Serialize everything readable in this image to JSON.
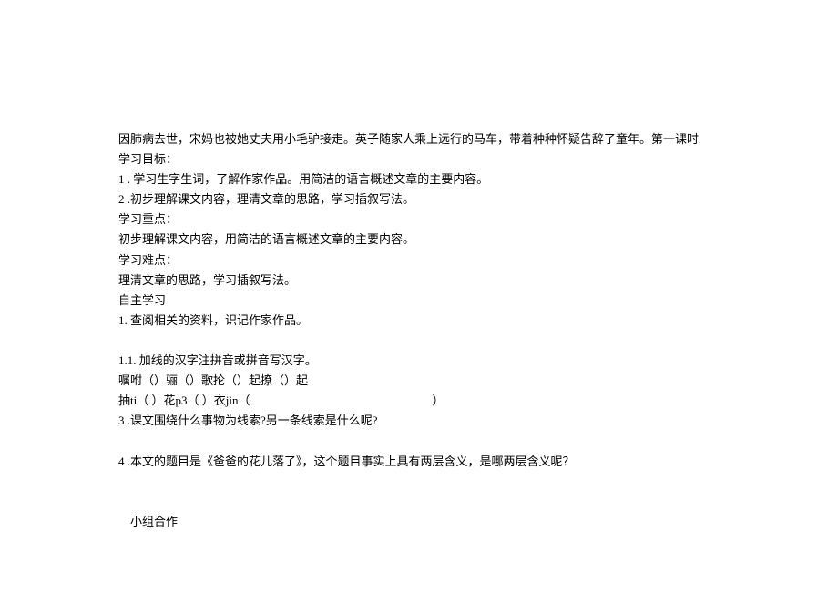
{
  "lines": {
    "l1": "因肺病去世，宋妈也被她丈夫用小毛驴接走。英子随家人乘上远行的马车，带着种种怀疑告辞了童年。第一课时",
    "l2": "学习目标：",
    "l3": "1 . 学习生字生词，了解作家作品。用简洁的语言概述文章的主要内容。",
    "l4": "2  .初步理解课文内容，理清文章的思路，学习插叙写法。",
    "l5": "学习重点：",
    "l6": "初步理解课文内容，用简洁的语言概述文章的主要内容。",
    "l7": "学习难点：",
    "l8": "理清文章的思路，学习插叙写法。",
    "l9": "自主学习",
    "l10": "1. 查阅相关的资料，识记作家作品。",
    "l11": "1.1.       加线的汉字注拼音或拼音写汉字。",
    "l12": "嘱咐（）骊（）歌抡（）起撩（）起",
    "l13a": "抽ti（  ）花p3（  ）衣jin（",
    "l13b": "）",
    "l14": "3   .课文围绕什么事物为线索?另一条线索是什么呢?",
    "l15": "4   .本文的题目是《爸爸的花儿落了》，这个题目事实上具有两层含义，是哪两层含义呢？",
    "l16": "小组合作"
  }
}
